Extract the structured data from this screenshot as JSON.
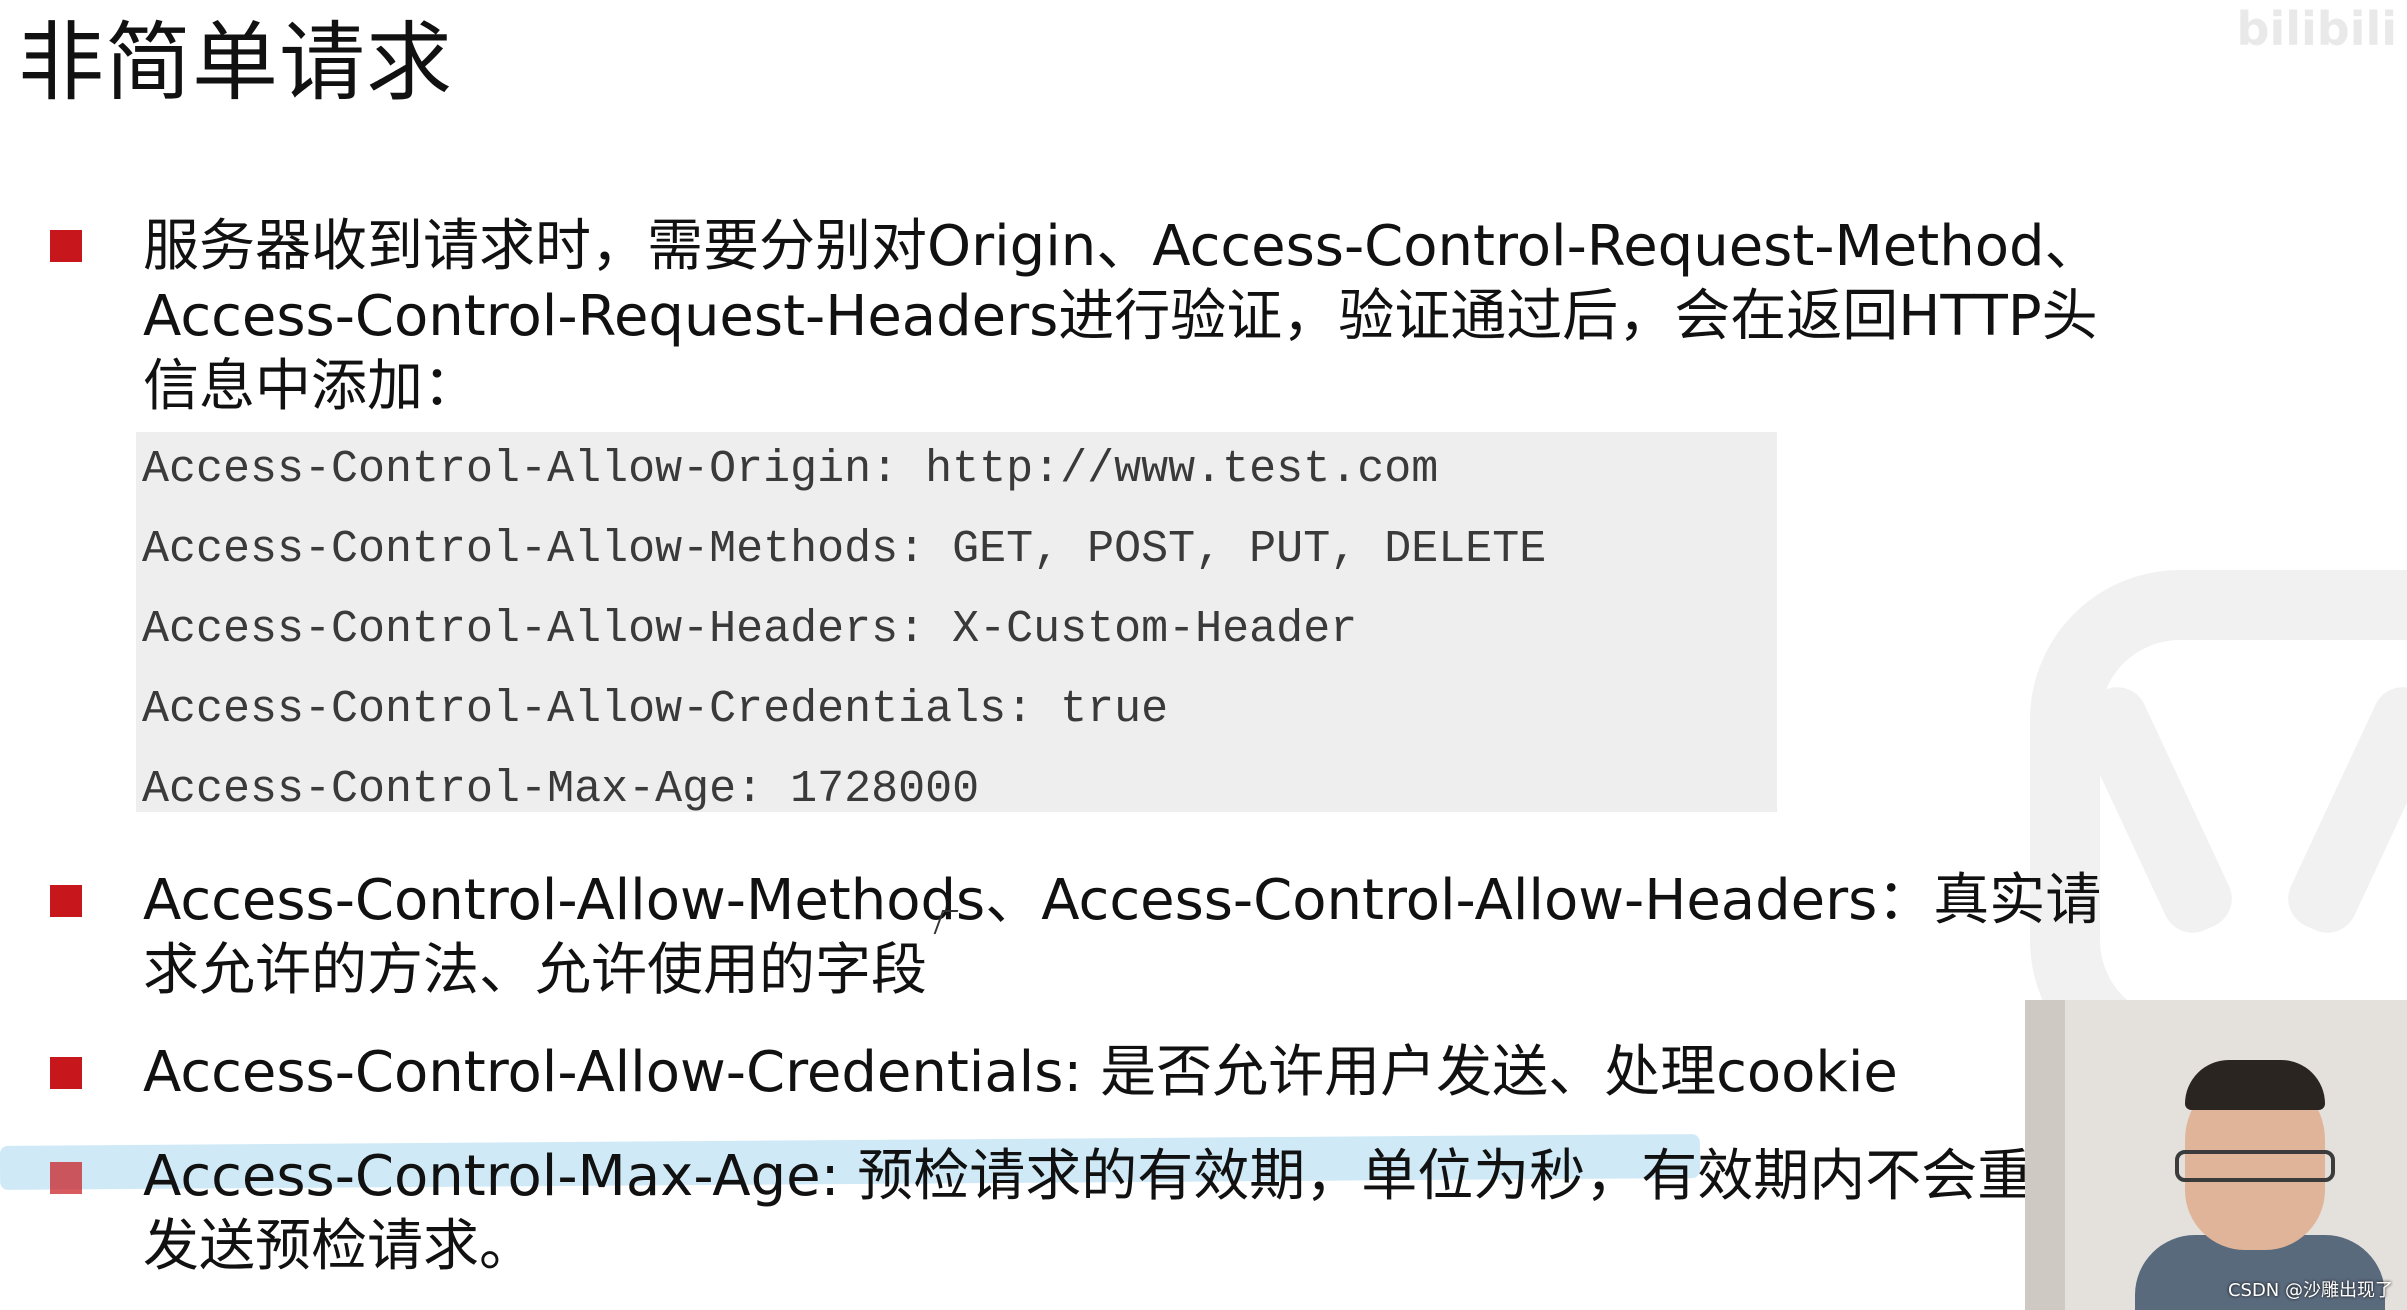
{
  "slide": {
    "title": "非简单请求",
    "bullet_color": "#c8161d",
    "bullets": [
      {
        "lines": [
          "服务器收到请求时，需要分别对Origin、Access-Control-Request-Method、",
          "Access-Control-Request-Headers进行验证，验证通过后，会在返回HTTP头",
          "信息中添加："
        ]
      },
      {
        "lines": [
          "Access-Control-Allow-Methods、Access-Control-Allow-Headers：真实请",
          "求允许的方法、允许使用的字段"
        ]
      },
      {
        "lines": [
          "Access-Control-Allow-Credentials: 是否允许用户发送、处理cookie"
        ]
      },
      {
        "lines": [
          "Access-Control-Max-Age: 预检请求的有效期，单位为秒，有效期内不会重",
          "发送预检请求。"
        ]
      }
    ],
    "code_lines": [
      "Access-Control-Allow-Origin: http://www.test.com",
      "Access-Control-Allow-Methods: GET, POST, PUT, DELETE",
      "Access-Control-Allow-Headers: X-Custom-Header",
      "Access-Control-Allow-Credentials: true",
      "Access-Control-Max-Age: 1728000"
    ]
  },
  "webcam": {
    "caption": "CSDN @沙雕出现了"
  },
  "icons": {
    "bullet": "red-square-bullet-icon",
    "cursor": "mouse-cursor-icon",
    "watermark": "bilibili-watermark-icon"
  }
}
